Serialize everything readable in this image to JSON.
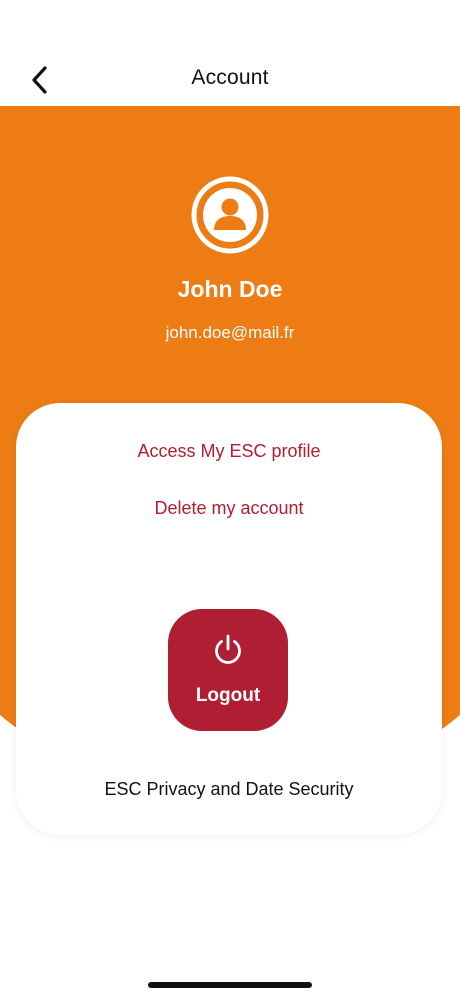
{
  "header": {
    "title": "Account",
    "back_icon": "chevron-left-icon"
  },
  "profile": {
    "avatar_icon": "user-circle-icon",
    "name": "John Doe",
    "email": "john.doe@mail.fr"
  },
  "actions": {
    "access_profile_label": "Access My ESC profile",
    "delete_account_label": "Delete my account",
    "logout_label": "Logout",
    "logout_icon": "power-icon",
    "privacy_label": "ESC Privacy and Date Security"
  },
  "colors": {
    "brand_orange": "#EC7C13",
    "accent_red": "#B01E33",
    "background": "#FFFFFF",
    "text_dark": "#111111"
  }
}
